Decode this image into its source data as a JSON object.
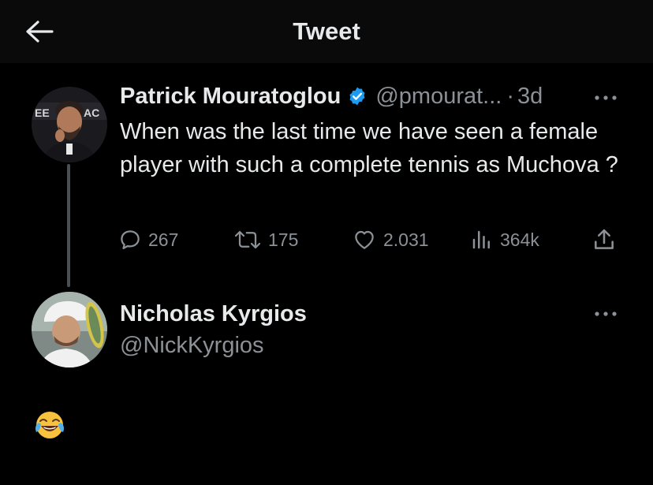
{
  "header": {
    "title": "Tweet",
    "back_icon": "arrow-left-icon"
  },
  "tweet1": {
    "author_name": "Patrick Mouratoglou",
    "handle": "@pmourat...",
    "separator": "·",
    "time": "3d",
    "verified_color": "#1d9bf0",
    "text": "When was the last time we have seen a female player with such a complete tennis as Muchova ?",
    "stats": {
      "replies": "267",
      "retweets": "175",
      "likes": "2.031",
      "views": "364k"
    }
  },
  "tweet2": {
    "author_name": "Nicholas Kyrgios",
    "handle": "@NickKyrgios",
    "reply_emoji": "face-with-tears-of-joy"
  }
}
